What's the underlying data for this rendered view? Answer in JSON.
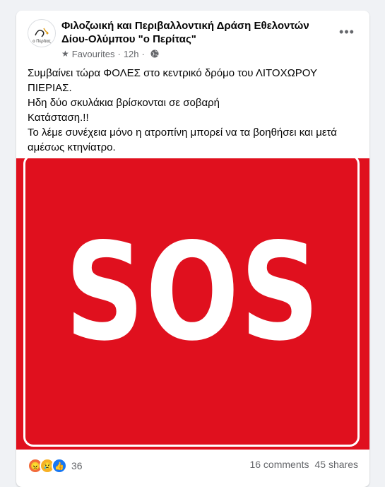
{
  "post": {
    "page_name": "Φιλοζωική και Περιβαλλοντική Δράση Εθελοντών Δίου-Ολύμπου \"ο Περίτας\"",
    "avatar_caption": "ο Περίτας",
    "audience": "Favourites",
    "time": "12h",
    "more_label": "•••",
    "text_lines": [
      "Συμβαίνει τώρα ΦΟΛΕΣ στο κεντρικό δρόμο του ΛΙΤΟΧΩΡΟΥ ΠΙΕΡΙΑΣ.",
      "Ηδη δύο σκυλάκια βρίσκονται σε σοβαρή",
      "Κατάσταση.!!",
      "Το λέμε συνέχεια μόνο η ατροπίνη μπορεί να τα βοηθήσει και μετά αμέσως κτηνίατρο."
    ],
    "image_text": "SOS",
    "image_colors": {
      "background": "#e0101e",
      "foreground": "#ffffff"
    }
  },
  "footer": {
    "reactions": [
      "angry",
      "sad",
      "like"
    ],
    "reaction_count": "36",
    "comments": "16 comments",
    "shares": "45 shares"
  }
}
